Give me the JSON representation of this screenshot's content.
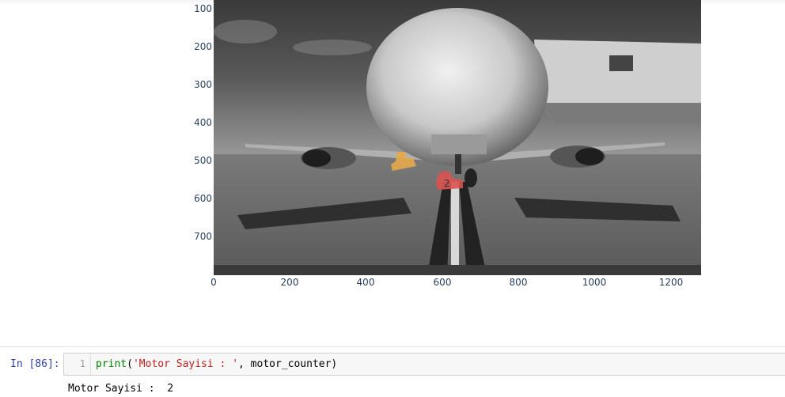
{
  "plot": {
    "y_ticks": [
      "100",
      "200",
      "300",
      "400",
      "500",
      "600",
      "700"
    ],
    "x_ticks": [
      "0",
      "200",
      "400",
      "600",
      "800",
      "1000",
      "1200"
    ],
    "image_description": "grayscale airplane nose at gate with jet bridge; two colored segmentation masks"
  },
  "cell": {
    "prompt": "In [86]:",
    "line_number": "1",
    "code_fn": "print",
    "code_open": "(",
    "code_string": "'Motor Sayisi : '",
    "code_rest": ", motor_counter)"
  },
  "output": {
    "text": "Motor Sayisi :  2"
  },
  "colors": {
    "tick_text": "#2a3f5f",
    "prompt": "#303f9f",
    "mask_orange": "#e8a84a",
    "mask_red": "#d9534f"
  }
}
